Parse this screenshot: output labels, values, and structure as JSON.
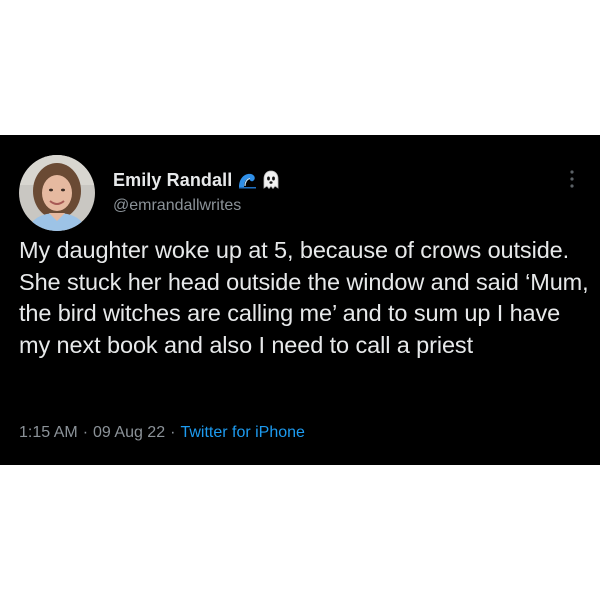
{
  "tweet": {
    "author": {
      "display_name": "Emily Randall",
      "handle": "@emrandallwrites",
      "name_emojis": [
        "wave-icon",
        "ghost-icon"
      ]
    },
    "text": "My daughter woke up at 5, because of crows outside. She stuck her head outside the window and said ‘Mum, the bird witches are calling me’ and to sum up I have my next book and also I need to call a priest",
    "meta": {
      "time": "1:15 AM",
      "separator": "·",
      "date": "09 Aug 22",
      "source": "Twitter for iPhone"
    },
    "more_icon": "more-vertical-icon"
  },
  "colors": {
    "card_background": "#000000",
    "page_background": "#ffffff",
    "text_primary": "#e7e9ea",
    "text_secondary": "#8b9298",
    "link": "#1d9bf0"
  }
}
